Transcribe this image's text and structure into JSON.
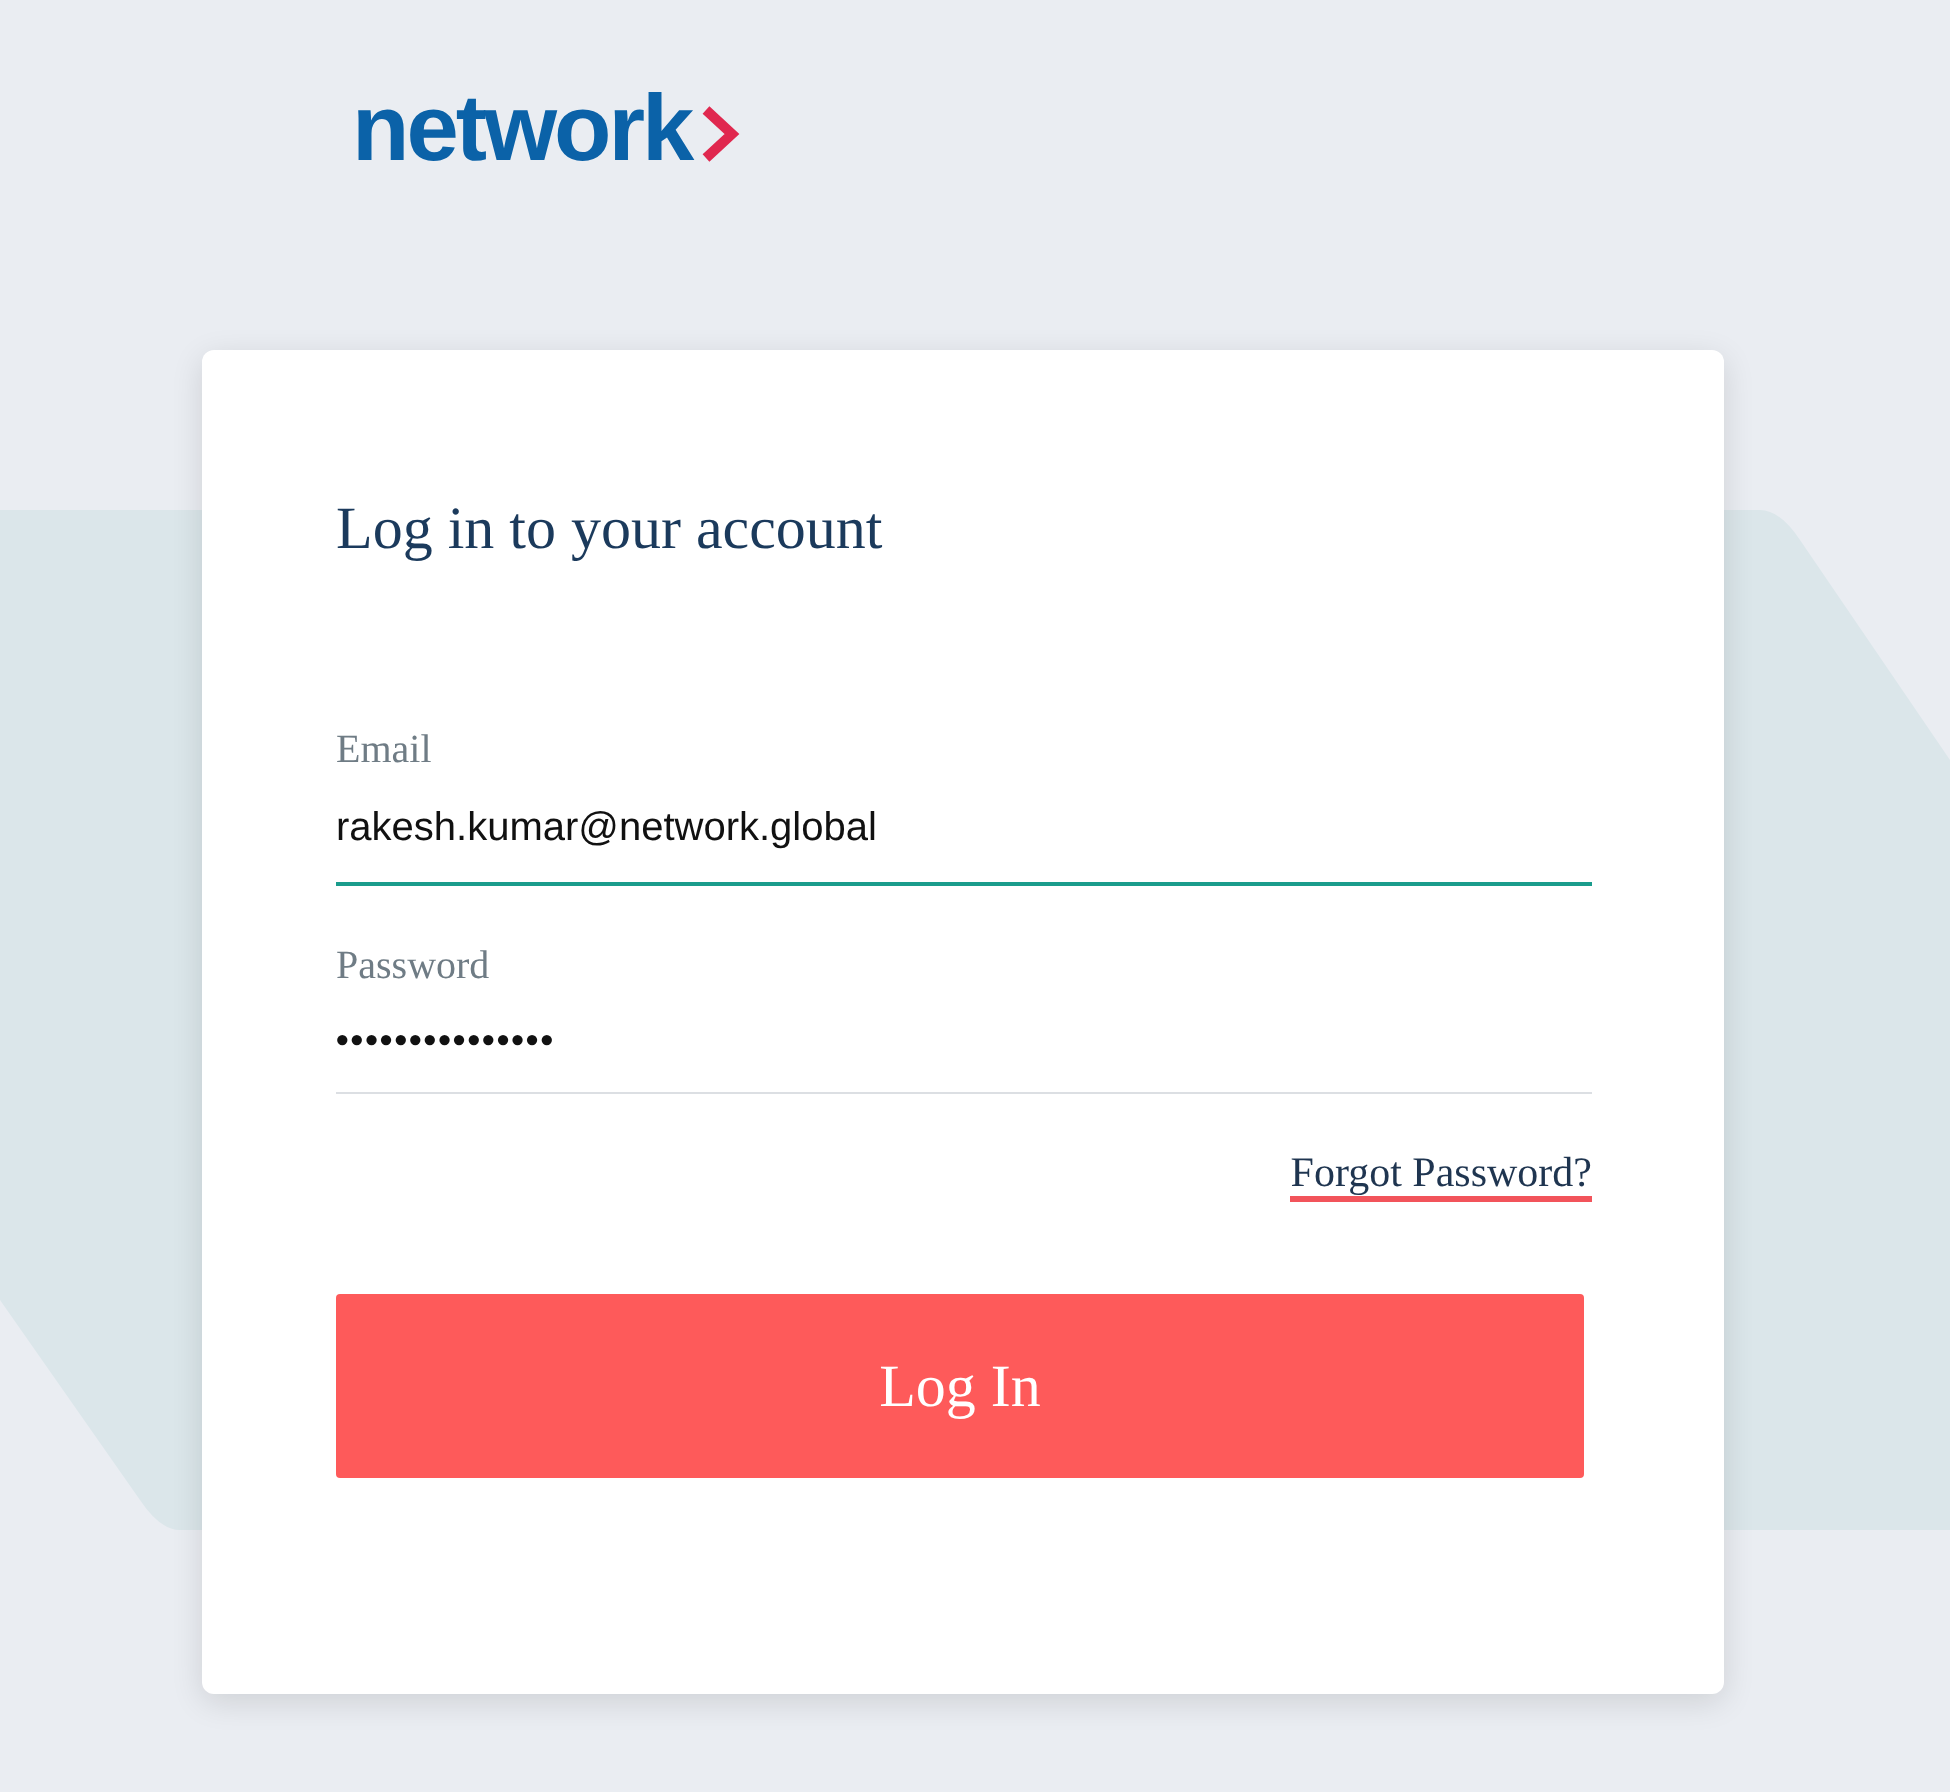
{
  "logo": {
    "text": "network"
  },
  "form": {
    "title": "Log in to your account",
    "fields": [
      {
        "label": "Email",
        "value": "rakesh.kumar@network.global",
        "kind": "text",
        "focused": true
      },
      {
        "label": "Password",
        "value": "•••••••••••••••",
        "kind": "password",
        "focused": false
      }
    ],
    "forgot_link": "Forgot Password?",
    "submit": "Log In"
  }
}
